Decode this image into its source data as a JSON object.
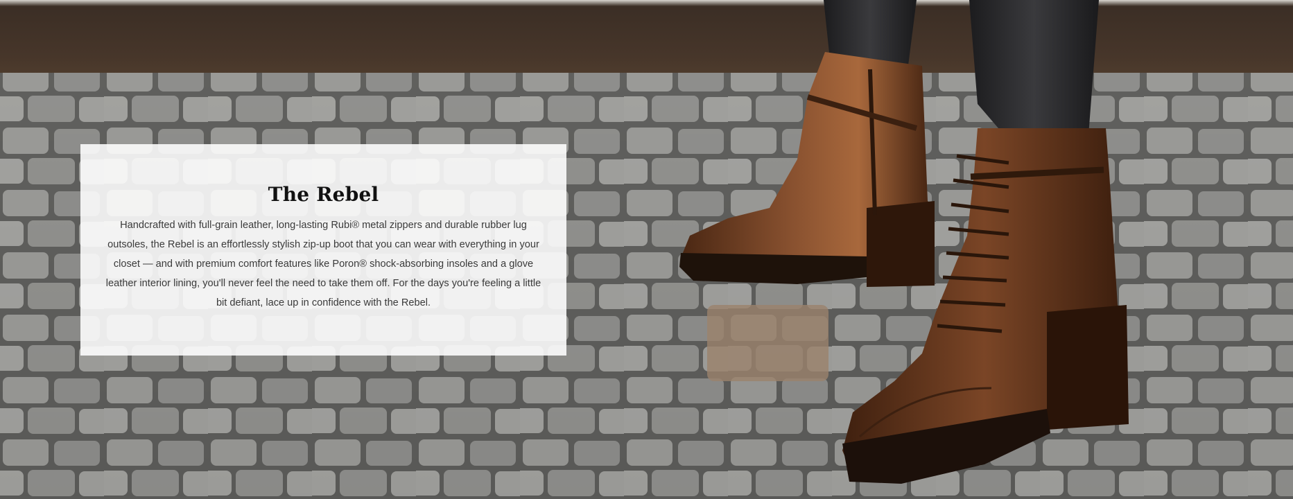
{
  "hero": {
    "title": "The Rebel",
    "description": "Handcrafted with full-grain leather, long-lasting Rubi® metal zippers and durable rubber lug outsoles, the Rebel is an effortlessly stylish zip-up boot that you can wear with everything in your closet — and with premium comfort features like Poron® shock-absorbing insoles and a glove leather interior lining, you'll never feel the need to take them off. For the days you're feeling a little bit defiant, lace up in confidence with the Rebel."
  },
  "colors": {
    "leather": "#6b3a1f",
    "cobblestone": "#8a8a88",
    "wall": "#3a2c22",
    "card": "#ffffff"
  }
}
